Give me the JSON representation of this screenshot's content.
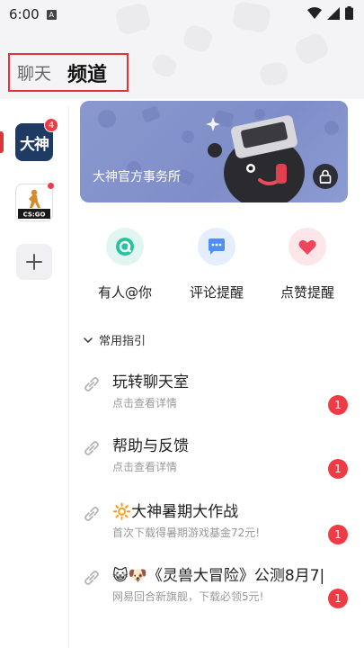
{
  "status_bar": {
    "time": "6:00",
    "app_indicator": "A"
  },
  "tabs": {
    "chat": "聊天",
    "channel": "频道"
  },
  "rail": {
    "items": [
      {
        "name": "大神",
        "badge": "4"
      },
      {
        "name": "CS:GO",
        "dot": true
      }
    ],
    "add_icon": "plus-icon"
  },
  "banner": {
    "title": "大神官方事务所"
  },
  "quick_actions": [
    {
      "label": "有人@你",
      "icon": "mention-icon",
      "color": "#27c3a0"
    },
    {
      "label": "评论提醒",
      "icon": "comment-icon",
      "color": "#4f8ef7"
    },
    {
      "label": "点赞提醒",
      "icon": "heart-icon",
      "color": "#f0445a"
    }
  ],
  "guides_section": {
    "header": "常用指引",
    "items": [
      {
        "title": "玩转聊天室",
        "subtitle": "点击查看详情",
        "count": "1"
      },
      {
        "title": "帮助与反馈",
        "subtitle": "点击查看详情",
        "count": "1"
      },
      {
        "title": "🔆大神暑期大作战",
        "subtitle": "首次下载得暑期游戏基金72元!",
        "count": "1"
      },
      {
        "title": "😺🐶《灵兽大冒险》公测8月7|",
        "subtitle": "网易回合新旗舰，下载必领5元!",
        "count": "1"
      }
    ]
  },
  "colors": {
    "accent": "#e0343b",
    "badge": "#ef3b43"
  }
}
